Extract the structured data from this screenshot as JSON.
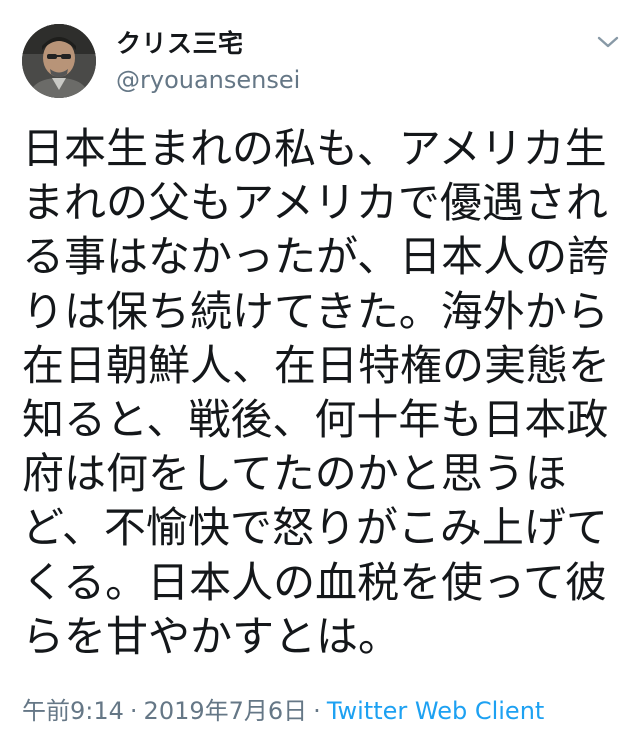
{
  "tweet": {
    "user": {
      "display_name": "クリス三宅",
      "handle": "@ryouansensei"
    },
    "text_lines": [
      "日本生まれの私も、アメリカ生",
      "まれの父もアメリカで優遇され",
      "る事はなかったが、日本人の誇",
      "りは保ち続けてきた。海外から",
      "在日朝鮮人、在日特権の実態を",
      "知ると、戦後、何十年も日本政",
      "府は何をしてたのかと思うほ",
      "ど、不愉快で怒りがこみ上げて",
      "くる。日本人の血税を使って彼",
      "らを甘やかすとは。"
    ],
    "time": "午前9:14",
    "separator": "·",
    "date": "2019年7月6日",
    "source": "Twitter Web Client"
  },
  "icons": {
    "menu": "chevron-down-icon",
    "avatar": "avatar-photo"
  },
  "colors": {
    "text": "#14171a",
    "secondary": "#657786",
    "link": "#1da1f2",
    "background": "#ffffff"
  }
}
